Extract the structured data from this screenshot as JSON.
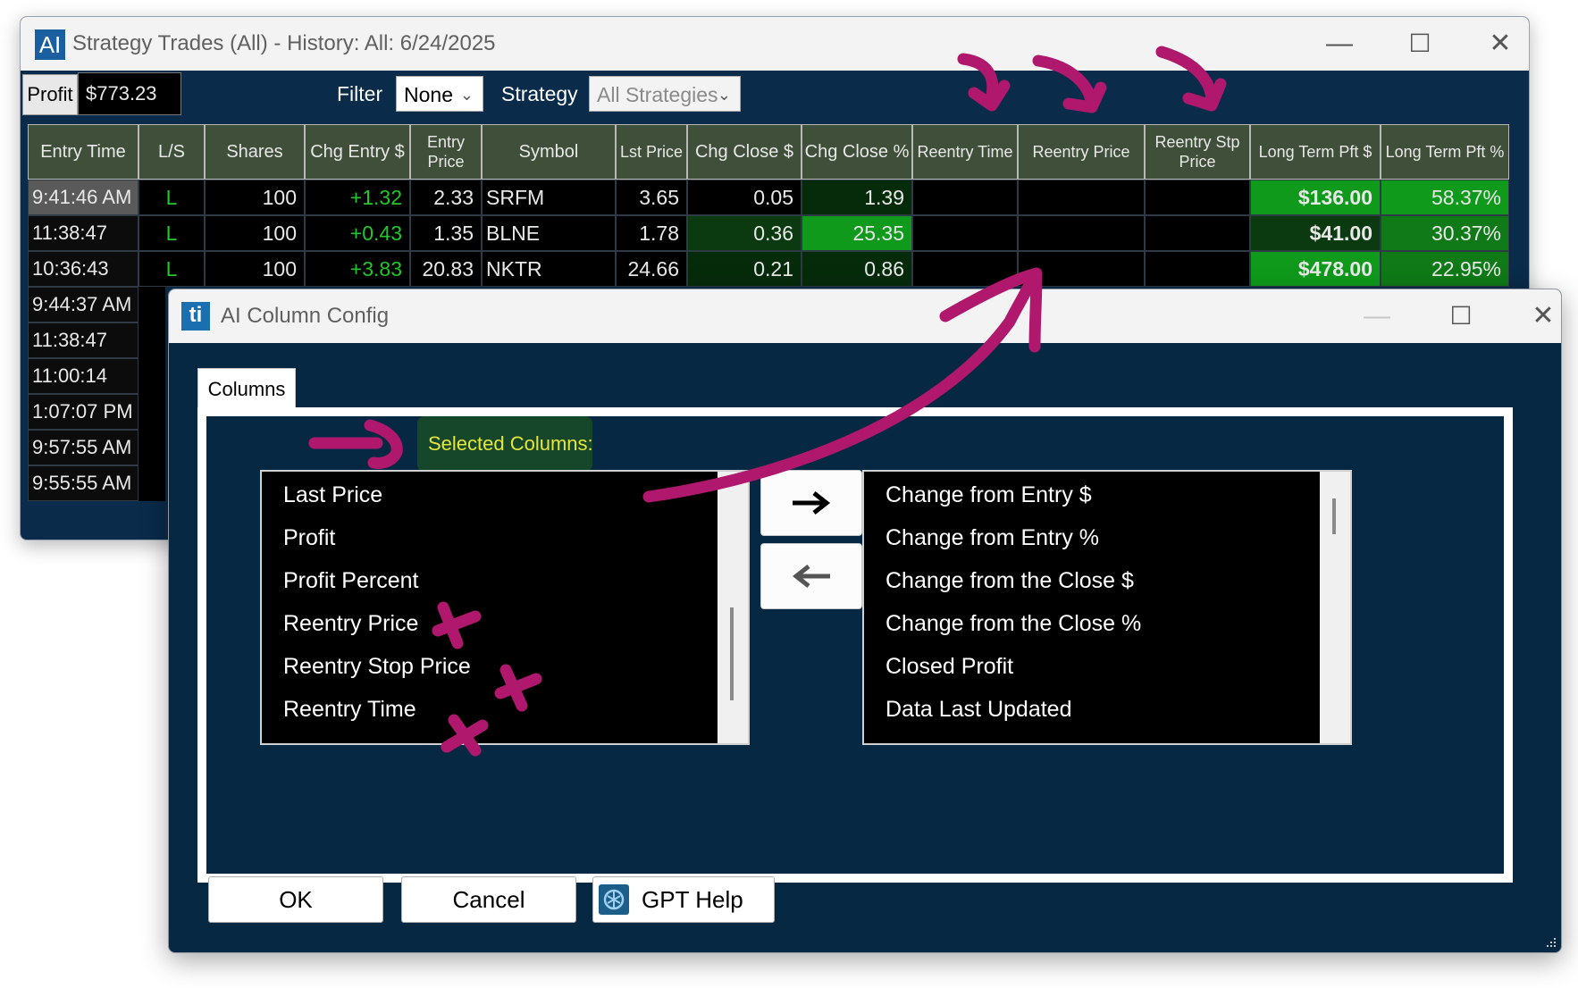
{
  "trades_window": {
    "title": "Strategy Trades (All) - History: All: 6/24/2025",
    "logo_text": "AI",
    "controls": {
      "minimize": "—",
      "maximize": "☐",
      "close": "✕"
    },
    "toolbar": {
      "profit_label": "Profit",
      "profit_value": "$773.23",
      "filter_label": "Filter",
      "filter_value": "None",
      "strategy_label": "Strategy",
      "strategy_value": "All Strategies"
    },
    "columns": [
      "Entry Time",
      "L/S",
      "Shares",
      "Chg Entry $",
      "Entry Price",
      "Symbol",
      "Lst Price",
      "Chg Close $",
      "Chg Close %",
      "Reentry Time",
      "Reentry Price",
      "Reentry Stp Price",
      "Long Term Pft $",
      "Long Term Pft %"
    ],
    "rows": [
      {
        "time": "9:41:46 AM",
        "ls": "L",
        "shares": "100",
        "chg_entry": "+1.32",
        "entry_price": "2.33",
        "symbol": "SRFM",
        "last_price": "3.65",
        "chg_close": "0.05",
        "chg_close_pct": "1.39",
        "reentry_time": "",
        "reentry_price": "",
        "reentry_stp": "",
        "lt_pft": "$136.00",
        "lt_pft_pct": "58.37%"
      },
      {
        "time": "11:38:47",
        "ls": "L",
        "shares": "100",
        "chg_entry": "+0.43",
        "entry_price": "1.35",
        "symbol": "BLNE",
        "last_price": "1.78",
        "chg_close": "0.36",
        "chg_close_pct": "25.35",
        "reentry_time": "",
        "reentry_price": "",
        "reentry_stp": "",
        "lt_pft": "$41.00",
        "lt_pft_pct": "30.37%"
      },
      {
        "time": "10:36:43",
        "ls": "L",
        "shares": "100",
        "chg_entry": "+3.83",
        "entry_price": "20.83",
        "symbol": "NKTR",
        "last_price": "24.66",
        "chg_close": "0.21",
        "chg_close_pct": "0.86",
        "reentry_time": "",
        "reentry_price": "",
        "reentry_stp": "",
        "lt_pft": "$478.00",
        "lt_pft_pct": "22.95%"
      }
    ],
    "hidden_rows_times": [
      "9:44:37 AM",
      "11:38:47",
      "11:00:14",
      "1:07:07 PM",
      "9:57:55 AM",
      "9:55:55 AM"
    ]
  },
  "config_dialog": {
    "title": "AI Column Config",
    "logo_text": "ti",
    "controls": {
      "minimize": "—",
      "maximize": "☐",
      "close": "✕"
    },
    "tab_label": "Columns",
    "selected_label": "Selected Columns:",
    "selected_columns": [
      "Last Price",
      "Profit",
      "Profit Percent",
      "Reentry Price",
      "Reentry Stop Price",
      "Reentry Time"
    ],
    "available_columns": [
      "Change from Entry $",
      "Change from Entry %",
      "Change from the Close $",
      "Change from the Close %",
      "Closed Profit",
      "Data Last Updated"
    ],
    "buttons": {
      "ok": "OK",
      "cancel": "Cancel",
      "gpt_help": "GPT Help"
    }
  },
  "colors": {
    "annotation_magenta": "#b0186e",
    "window_background": "#0a2b4a",
    "positive_green": "#23c62b",
    "bright_green_cell": "#0f9a1b",
    "dark_green_cell": "#0b3a10",
    "highlight_yellow": "#e6e63a"
  }
}
